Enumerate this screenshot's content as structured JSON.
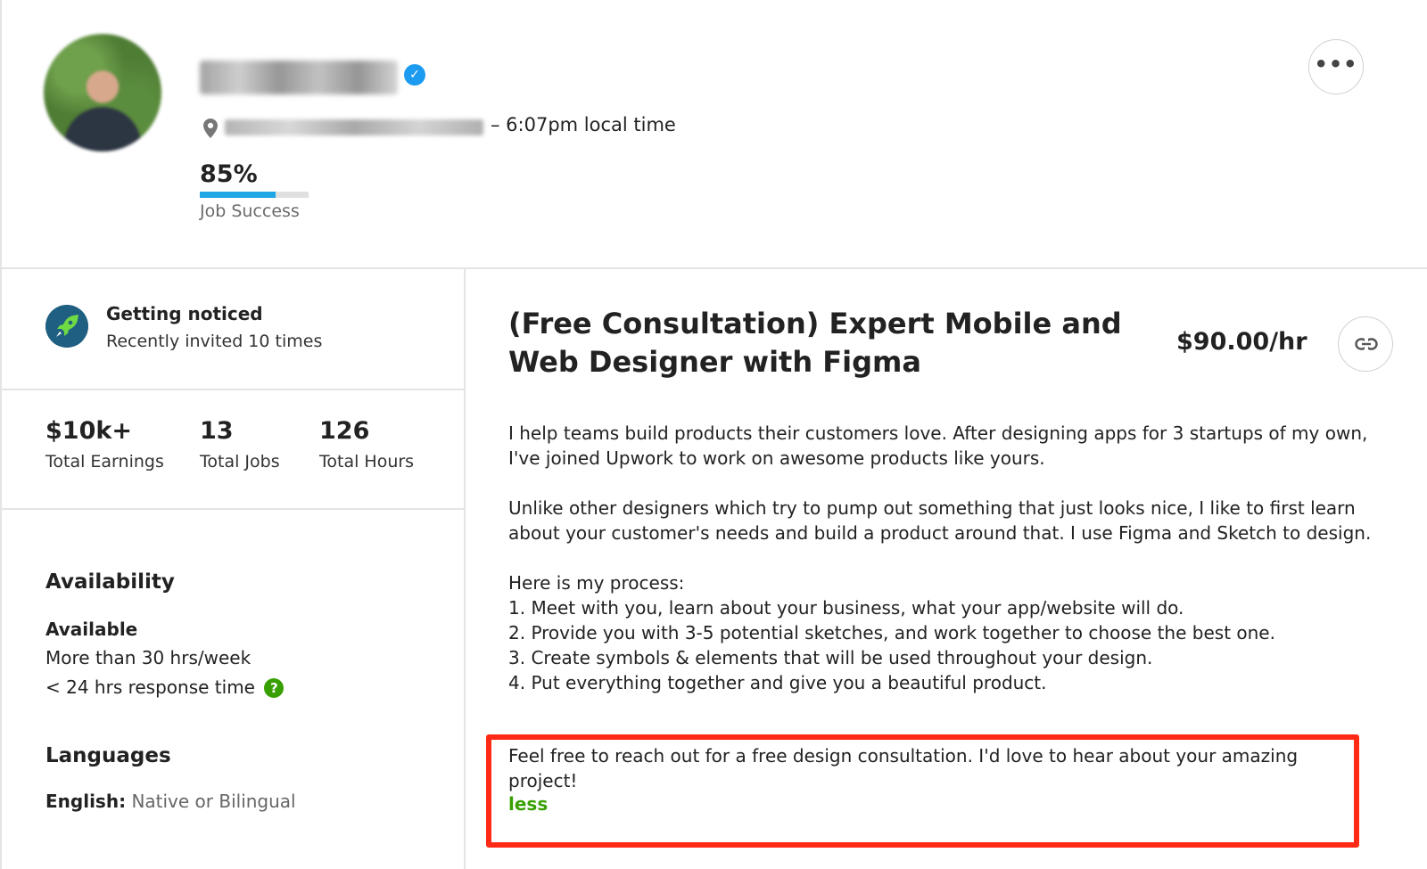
{
  "header": {
    "local_time": "– 6:07pm local time",
    "job_success": {
      "value": "85%",
      "fraction": 0.7,
      "label": "Job Success"
    },
    "more_label": "•••"
  },
  "notice": {
    "title": "Getting noticed",
    "subtitle": "Recently invited 10 times"
  },
  "stats": [
    {
      "value": "$10k+",
      "label": "Total Earnings"
    },
    {
      "value": "13",
      "label": "Total Jobs"
    },
    {
      "value": "126",
      "label": "Total Hours"
    }
  ],
  "availability": {
    "heading": "Availability",
    "status": "Available",
    "hours": "More than 30 hrs/week",
    "response": "< 24 hrs response time"
  },
  "languages": {
    "heading": "Languages",
    "items": [
      {
        "name": "English:",
        "level": "Native or Bilingual"
      }
    ]
  },
  "profile": {
    "title": "(Free Consultation) Expert Mobile and Web Designer with Figma",
    "rate": "$90.00/hr",
    "description": [
      "I help teams build products their customers love. After designing apps for 3 startups of my own, I've joined Upwork to work on awesome products like yours.",
      "Unlike other designers which try to pump out something that just looks nice, I like to first learn about your customer's needs and build a product around that. I use Figma and Sketch to design.",
      "Here is my process:\n1. Meet with you, learn about your business, what your app/website will do.\n2. Provide you with 3-5 potential sketches, and work together to choose the best one.\n3. Create symbols & elements that will be used throughout your design.\n4. Put everything together and give you a beautiful product."
    ],
    "cta": "Feel free to reach out for a free design consultation. I'd love to hear about your amazing project!",
    "less_label": "less"
  },
  "colors": {
    "accent_green": "#37a000",
    "job_bar": "#1ea6e5",
    "highlight": "#ff2a16",
    "verified": "#1d9bf0"
  },
  "icons": [
    "verified-icon",
    "location-pin-icon",
    "more-icon",
    "rocket-icon",
    "link-icon",
    "help-icon"
  ]
}
